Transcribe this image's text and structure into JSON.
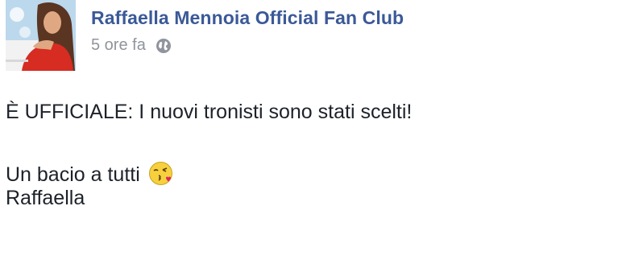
{
  "post": {
    "author": "Raffaella Mennoia Official Fan Club",
    "timestamp": "5 ore fa",
    "privacy_icon": "globe-icon",
    "avatar_icon": "profile-photo",
    "lines": [
      "È UFFICIALE: I nuovi tronisti sono stati scelti!",
      "Un bacio a tutti",
      "Raffaella"
    ],
    "emoji": "kiss-face-emoji"
  },
  "colors": {
    "author": "#3b5998",
    "meta": "#90949c",
    "text": "#1d2129"
  }
}
